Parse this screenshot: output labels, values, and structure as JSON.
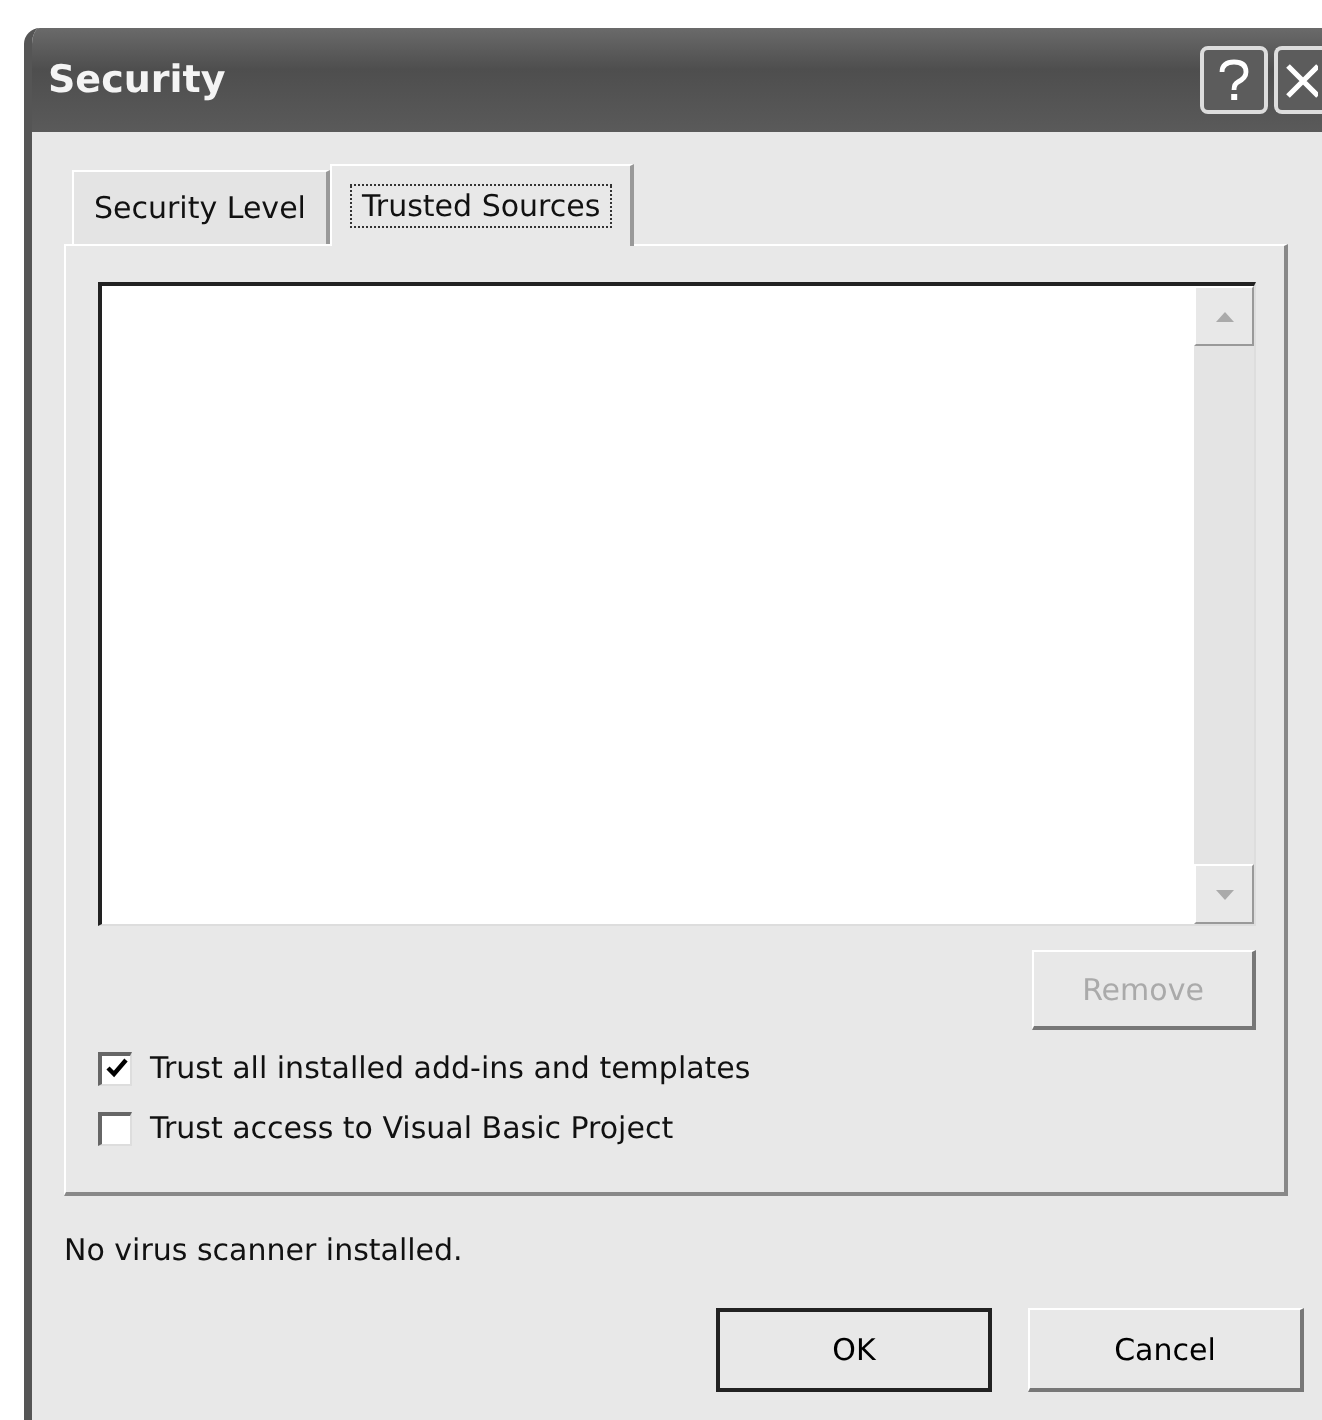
{
  "window": {
    "title": "Security"
  },
  "tabs": [
    {
      "label": "Security Level",
      "selected": false
    },
    {
      "label": "Trusted Sources",
      "selected": true
    }
  ],
  "remove_button": {
    "label": "Remove",
    "disabled": true
  },
  "checkboxes": [
    {
      "label": "Trust all installed add-ins and templates",
      "checked": true
    },
    {
      "label": "Trust access to Visual Basic Project",
      "checked": false
    }
  ],
  "status": "No virus scanner installed.",
  "buttons": [
    {
      "label": "OK",
      "default": true
    },
    {
      "label": "Cancel",
      "default": false
    }
  ]
}
